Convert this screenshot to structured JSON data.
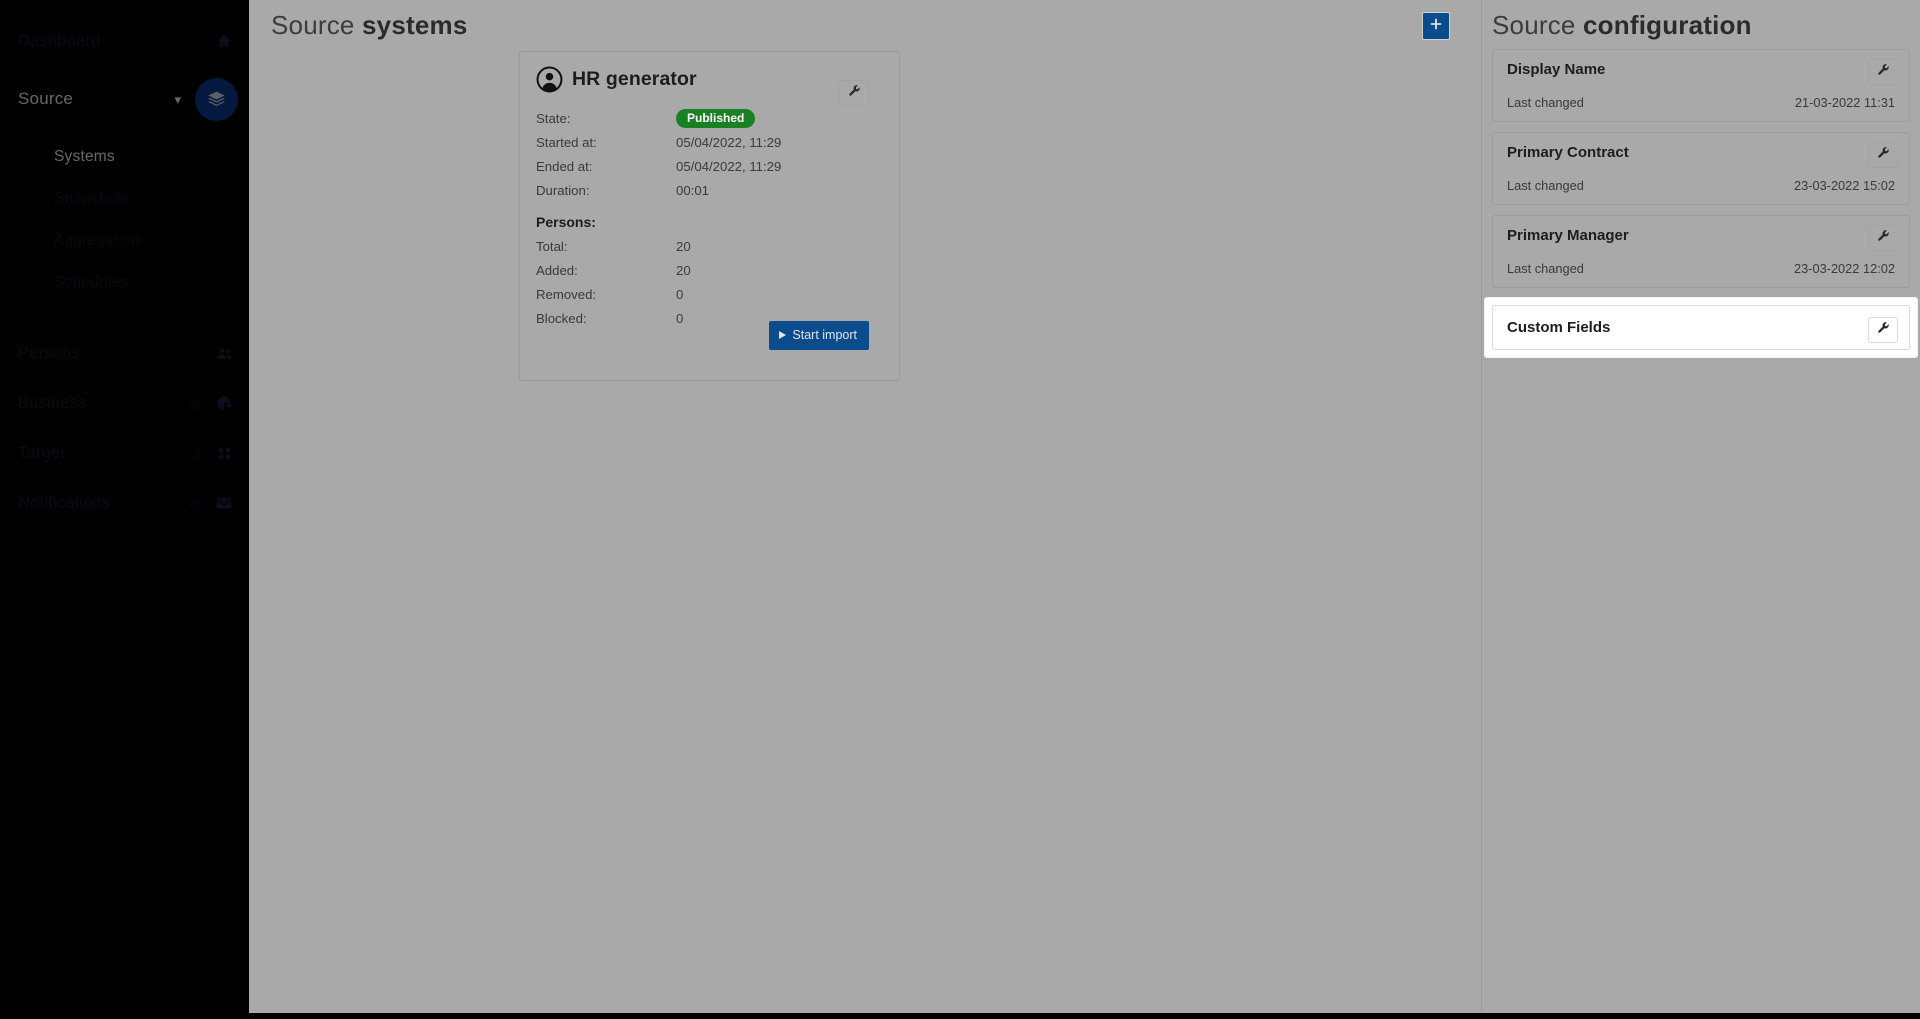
{
  "sidebar": {
    "items": [
      {
        "label": "Dashboard",
        "icon": "home-icon",
        "has_chevron": false,
        "state": "dim"
      },
      {
        "label": "Source",
        "icon": "layers-icon",
        "has_chevron": true,
        "state": "active"
      },
      {
        "label": "Persons",
        "icon": "people-icon",
        "has_chevron": false,
        "state": "dim"
      },
      {
        "label": "Business",
        "icon": "pie-chart-icon",
        "has_chevron": true,
        "state": "dim"
      },
      {
        "label": "Target",
        "icon": "grid-icon",
        "has_chevron": true,
        "state": "dim"
      },
      {
        "label": "Notifications",
        "icon": "envelope-icon",
        "has_chevron": true,
        "state": "dim"
      }
    ],
    "subnav": [
      {
        "label": "Systems",
        "state": "active"
      },
      {
        "label": "Snapshots",
        "state": "dimmed"
      },
      {
        "label": "Aggregation",
        "state": "dimmed"
      },
      {
        "label": "Schedules",
        "state": "dimmed"
      }
    ]
  },
  "main": {
    "title_prefix": "Source ",
    "title_strong": "systems",
    "add_button_icon": "plus-icon",
    "system_card": {
      "name": "HR generator",
      "avatar_icon": "user-avatar-icon",
      "tool_icon": "wrench-icon",
      "fields": [
        {
          "label": "State:",
          "value": "Published",
          "type": "badge"
        },
        {
          "label": "Started at:",
          "value": "05/04/2022, 11:29",
          "type": "text"
        },
        {
          "label": "Ended at:",
          "value": "05/04/2022, 11:29",
          "type": "text"
        },
        {
          "label": "Duration:",
          "value": "00:01",
          "type": "text"
        }
      ],
      "persons_heading": "Persons:",
      "persons": [
        {
          "label": "Total:",
          "value": "20"
        },
        {
          "label": "Added:",
          "value": "20"
        },
        {
          "label": "Removed:",
          "value": "0"
        },
        {
          "label": "Blocked:",
          "value": "0"
        }
      ],
      "start_import_label": "Start import"
    }
  },
  "right_panel": {
    "title_prefix": "Source ",
    "title_strong": "configuration",
    "last_changed_label": "Last changed",
    "tool_icon": "wrench-icon",
    "cards": [
      {
        "name": "Display Name",
        "last_changed_label": "Last changed",
        "timestamp": "21-03-2022 11:31",
        "highlighted": false
      },
      {
        "name": "Primary Contract",
        "last_changed_label": "Last changed",
        "timestamp": "23-03-2022 15:02",
        "highlighted": false
      },
      {
        "name": "Primary Manager",
        "last_changed_label": "Last changed",
        "timestamp": "23-03-2022 12:02",
        "highlighted": false
      },
      {
        "name": "Custom Fields",
        "last_changed_label": "",
        "timestamp": "",
        "highlighted": true
      }
    ]
  },
  "colors": {
    "sidebar_bg": "#000000",
    "accent_blue": "#0b4c8c",
    "source_badge_blue": "#0b3f9e",
    "published_green": "#198023",
    "scrim_gray": "#a9a9a9",
    "highlight_white": "#ffffff"
  }
}
